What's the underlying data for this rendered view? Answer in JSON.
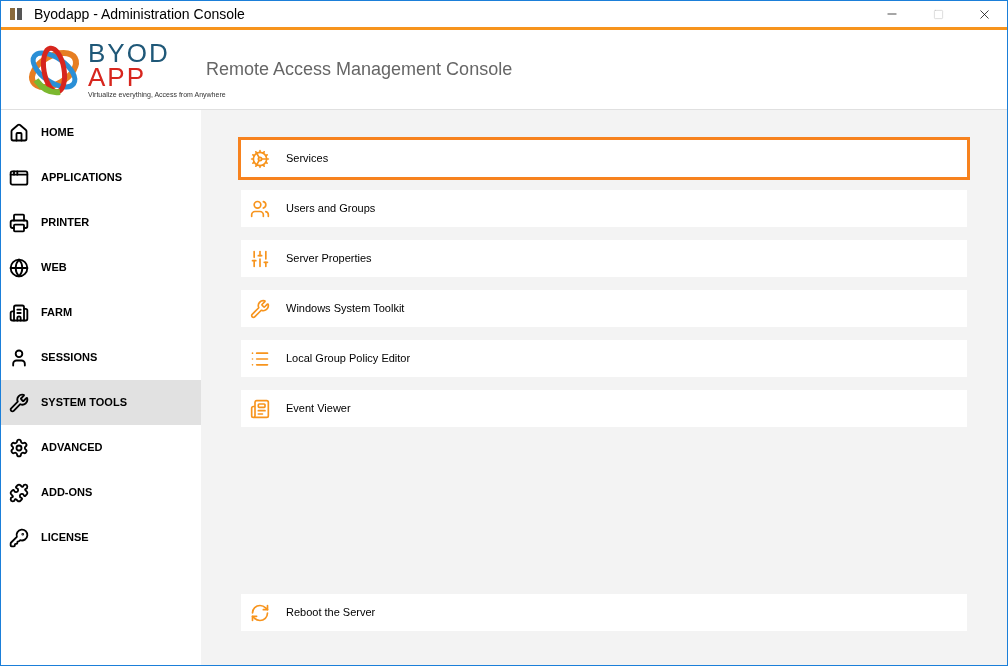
{
  "window": {
    "title": "Byodapp - Administration Console"
  },
  "header": {
    "logo_top": "BYOD",
    "logo_bottom": "APP",
    "logo_tagline": "Virtualize everything, Access from Anywhere",
    "title": "Remote Access Management Console"
  },
  "sidebar": {
    "items": [
      {
        "label": "HOME",
        "selected": false
      },
      {
        "label": "APPLICATIONS",
        "selected": false
      },
      {
        "label": "PRINTER",
        "selected": false
      },
      {
        "label": "WEB",
        "selected": false
      },
      {
        "label": "FARM",
        "selected": false
      },
      {
        "label": "SESSIONS",
        "selected": false
      },
      {
        "label": "SYSTEM TOOLS",
        "selected": true
      },
      {
        "label": "ADVANCED",
        "selected": false
      },
      {
        "label": "ADD-ONS",
        "selected": false
      },
      {
        "label": "LICENSE",
        "selected": false
      }
    ]
  },
  "tools": [
    {
      "label": "Services",
      "selected": true
    },
    {
      "label": "Users and Groups",
      "selected": false
    },
    {
      "label": "Server Properties",
      "selected": false
    },
    {
      "label": "Windows System Toolkit",
      "selected": false
    },
    {
      "label": "Local Group Policy Editor",
      "selected": false
    },
    {
      "label": "Event Viewer",
      "selected": false
    }
  ],
  "footer_action": {
    "label": "Reboot the Server"
  }
}
